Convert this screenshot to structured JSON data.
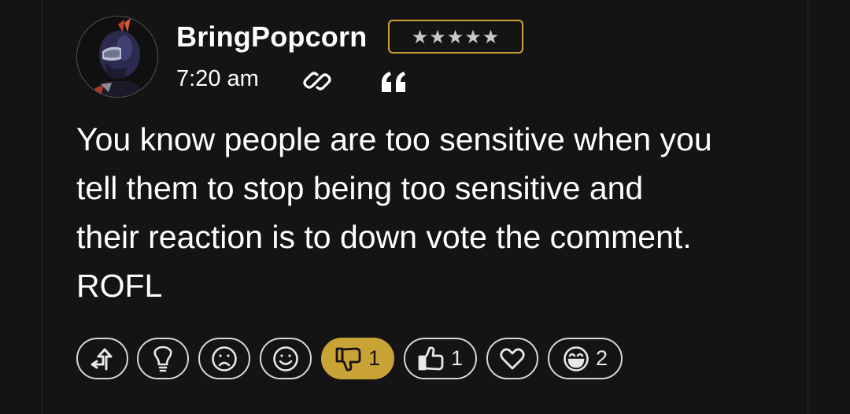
{
  "author": {
    "username": "BringPopcorn",
    "rank_stars": "★★★★★",
    "avatar_icon": "helmet-avatar-icon"
  },
  "meta": {
    "timestamp": "7:20 am",
    "link_icon": "link-icon",
    "quote_icon": "quote-icon"
  },
  "comment": {
    "lines": [
      "You know people are too sensitive when you",
      "tell them to stop being too sensitive and",
      "their reaction is to down vote the comment.",
      "ROFL"
    ]
  },
  "reactions": [
    {
      "icon": "reply-icon",
      "count": ""
    },
    {
      "icon": "lightbulb-icon",
      "count": ""
    },
    {
      "icon": "sad-face-icon",
      "count": ""
    },
    {
      "icon": "smile-face-icon",
      "count": ""
    },
    {
      "icon": "thumbs-down-icon",
      "count": "1",
      "active": true
    },
    {
      "icon": "thumbs-up-icon",
      "count": "1"
    },
    {
      "icon": "heart-icon",
      "count": ""
    },
    {
      "icon": "laugh-face-icon",
      "count": "2"
    }
  ],
  "colors": {
    "background": "#141414",
    "accent_gold": "#c9a336",
    "text": "#ffffff"
  }
}
